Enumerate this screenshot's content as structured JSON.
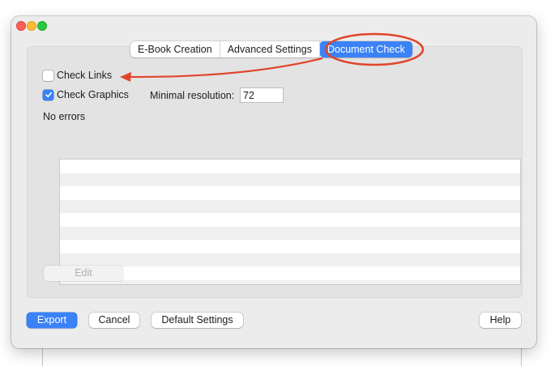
{
  "tabs": [
    {
      "label": "E-Book Creation",
      "active": false
    },
    {
      "label": "Advanced Settings",
      "active": false
    },
    {
      "label": "Document Check",
      "active": true
    }
  ],
  "options": {
    "check_links": {
      "label": "Check Links",
      "checked": false
    },
    "check_graphics": {
      "label": "Check Graphics",
      "checked": true
    },
    "min_resolution_label": "Minimal resolution:",
    "min_resolution_value": "72"
  },
  "status_text": "No errors",
  "error_list_rows": [],
  "buttons": {
    "edit": "Edit",
    "export": "Export",
    "cancel": "Cancel",
    "default_settings": "Default Settings",
    "help": "Help"
  },
  "colors": {
    "accent": "#3b82f7",
    "annotation": "#e0452c"
  }
}
